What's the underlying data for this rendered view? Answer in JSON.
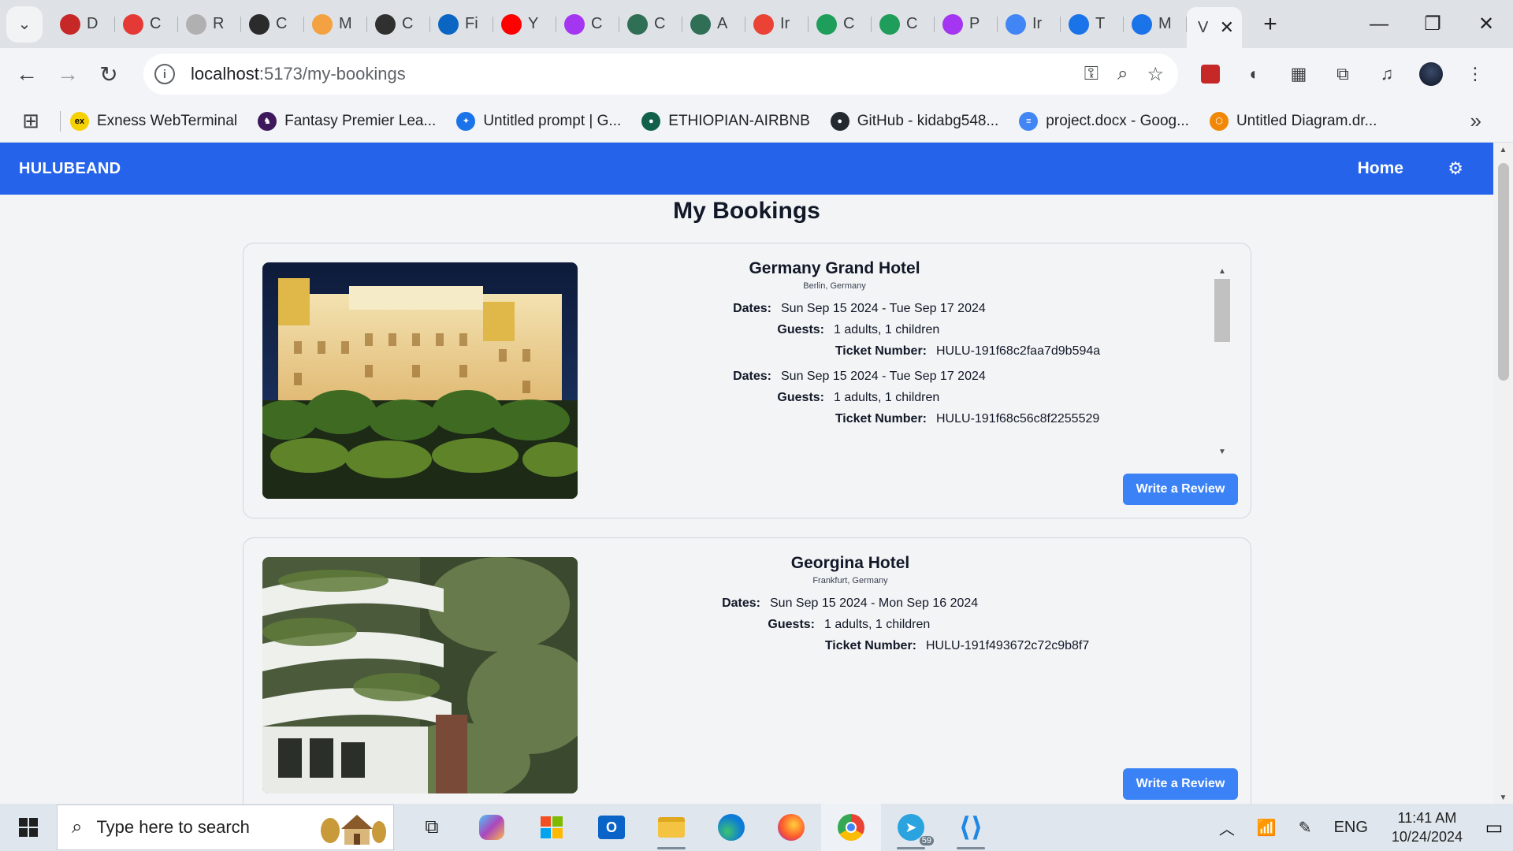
{
  "browser": {
    "tabs": [
      {
        "letter": "D",
        "icon": "shield-icon",
        "color": "#c62828"
      },
      {
        "letter": "C",
        "icon": "youtube-icon",
        "color": "#e53935"
      },
      {
        "letter": "R",
        "icon": "circle-icon",
        "color": "#b0b0b0"
      },
      {
        "letter": "C",
        "icon": "edx-icon",
        "color": "#2b2b2b"
      },
      {
        "letter": "M",
        "icon": "gl-icon",
        "color": "#f4a142"
      },
      {
        "letter": "C",
        "icon": "chatgpt-icon",
        "color": "#303030"
      },
      {
        "letter": "Fi",
        "icon": "linkedin-icon",
        "color": "#0a66c2"
      },
      {
        "letter": "Y",
        "icon": "youtube-icon",
        "color": "#ff0000"
      },
      {
        "letter": "C",
        "icon": "udemy-icon",
        "color": "#a435f0"
      },
      {
        "letter": "C",
        "icon": "ring-icon",
        "color": "#2f6f55"
      },
      {
        "letter": "A",
        "icon": "ring-icon",
        "color": "#2f6f55"
      },
      {
        "letter": "Ir",
        "icon": "gmail-icon",
        "color": "#ea4335"
      },
      {
        "letter": "C",
        "icon": "q-icon",
        "color": "#1e9e5a"
      },
      {
        "letter": "C",
        "icon": "q-icon",
        "color": "#1e9e5a"
      },
      {
        "letter": "P",
        "icon": "udemy-icon",
        "color": "#a435f0"
      },
      {
        "letter": "Ir",
        "icon": "google-icon",
        "color": "#4285f4"
      },
      {
        "letter": "T",
        "icon": "c-icon",
        "color": "#1a73e8"
      },
      {
        "letter": "M",
        "icon": "c-icon",
        "color": "#1a73e8"
      }
    ],
    "active_tab_label": "V",
    "url_host": "localhost",
    "url_path": ":5173/my-bookings",
    "bookmarks": [
      {
        "label": "Exness WebTerminal",
        "color": "#f7d000",
        "text": "ex"
      },
      {
        "label": "Fantasy Premier Lea...",
        "color": "#3d195b",
        "text": "♞"
      },
      {
        "label": "Untitled prompt | G...",
        "color": "#1a73e8",
        "text": "✦"
      },
      {
        "label": "ETHIOPIAN-AIRBNB",
        "color": "#116149",
        "text": "●"
      },
      {
        "label": "GitHub - kidabg548...",
        "color": "#24292f",
        "text": "●"
      },
      {
        "label": "project.docx - Goog...",
        "color": "#4285f4",
        "text": "≡"
      },
      {
        "label": "Untitled Diagram.dr...",
        "color": "#f08705",
        "text": "⬡"
      }
    ]
  },
  "app": {
    "brand": "HULUBEAND",
    "nav_home": "Home",
    "page_title": "My Bookings",
    "bookings": [
      {
        "hotel": "Germany Grand Hotel",
        "location": "Berlin, Germany",
        "entries": [
          {
            "dates_label": "Dates:",
            "dates": "Sun Sep 15 2024 - Tue Sep 17 2024",
            "guests_label": "Guests:",
            "guests": "1 adults, 1 children",
            "ticket_label": "Ticket Number:",
            "ticket": "HULU-191f68c2faa7d9b594a"
          },
          {
            "dates_label": "Dates:",
            "dates": "Sun Sep 15 2024 - Tue Sep 17 2024",
            "guests_label": "Guests:",
            "guests": "1 adults, 1 children",
            "ticket_label": "Ticket Number:",
            "ticket": "HULU-191f68c56c8f2255529"
          }
        ],
        "review_button": "Write a Review"
      },
      {
        "hotel": "Georgina Hotel",
        "location": "Frankfurt, Germany",
        "entries": [
          {
            "dates_label": "Dates:",
            "dates": "Sun Sep 15 2024 - Mon Sep 16 2024",
            "guests_label": "Guests:",
            "guests": "1 adults, 1 children",
            "ticket_label": "Ticket Number:",
            "ticket": "HULU-191f493672c72c9b8f7"
          }
        ],
        "review_button": "Write a Review"
      }
    ]
  },
  "taskbar": {
    "search_placeholder": "Type here to search",
    "language": "ENG",
    "time": "11:41 AM",
    "date": "10/24/2024",
    "telegram_badge": "59"
  }
}
